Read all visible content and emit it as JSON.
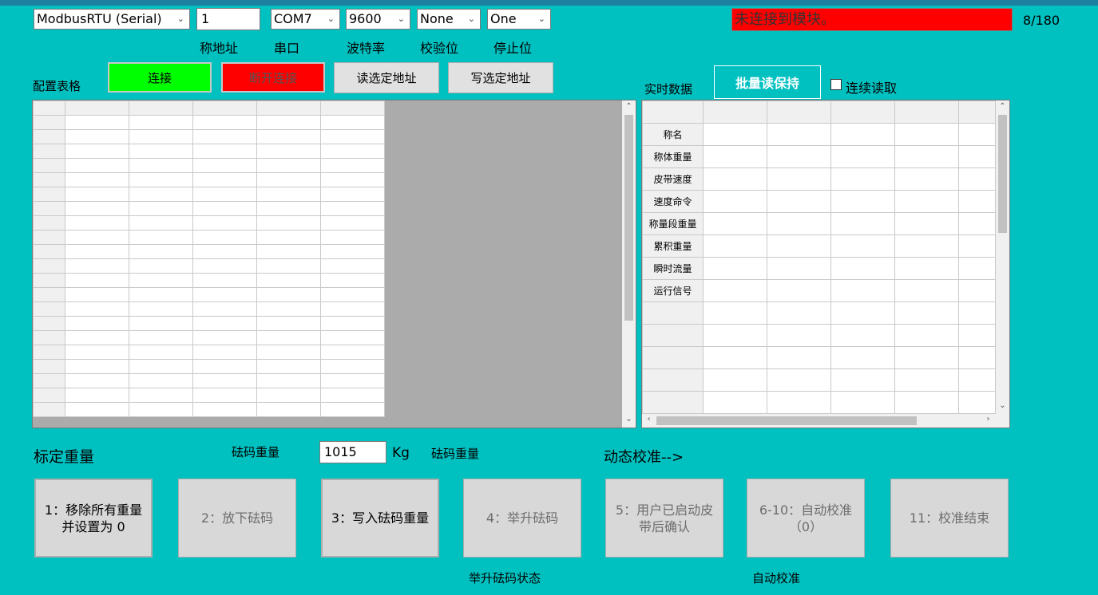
{
  "connection": {
    "protocol": "ModbusRTU (Serial)",
    "address_value": "1",
    "port": "COM7",
    "baud": "9600",
    "parity": "None",
    "stop_bits": "One"
  },
  "labels": {
    "address": "称地址",
    "port": "串口",
    "baud": "波特率",
    "parity": "校验位",
    "stop_bits": "停止位"
  },
  "status": {
    "message": "未连接到模块。",
    "counter": "8/180"
  },
  "buttons": {
    "connect": "连接",
    "disconnect": "断开连接",
    "read_selected": "读选定地址",
    "write_selected": "写选定地址",
    "batch_read": "批量读保持"
  },
  "config_table": {
    "title": "配置表格"
  },
  "realtime": {
    "title": "实时数据",
    "continuous_label": "连续读取",
    "rows": [
      "称名",
      "称体重量",
      "皮带速度",
      "速度命令",
      "称量段重量",
      "累积重量",
      "瞬时流量",
      "运行信号"
    ]
  },
  "calibration": {
    "title": "标定重量",
    "weight_label": "砝码重量",
    "weight_value": "1015",
    "unit": "Kg",
    "weight_label2": "砝码重量",
    "dynamic_label": "动态校准-->",
    "steps": [
      "1：移除所有重量并设置为 0",
      "2：放下砝码",
      "3：写入砝码重量",
      "4：举升砝码",
      "5：用户已启动皮带后确认",
      "6-10：自动校准（0）",
      "11：校准结束"
    ],
    "lift_status": "举升砝码状态",
    "auto_calib": "自动校准"
  },
  "icons": {
    "dropdown": "chevron-down-icon",
    "scroll_up": "chevron-up-icon",
    "scroll_down": "chevron-down-icon",
    "scroll_left": "chevron-left-icon",
    "scroll_right": "chevron-right-icon"
  },
  "colors": {
    "background": "#00c0c0",
    "connect": "#00ff00",
    "disconnect": "#ff0000",
    "status_error": "#ff0000"
  }
}
